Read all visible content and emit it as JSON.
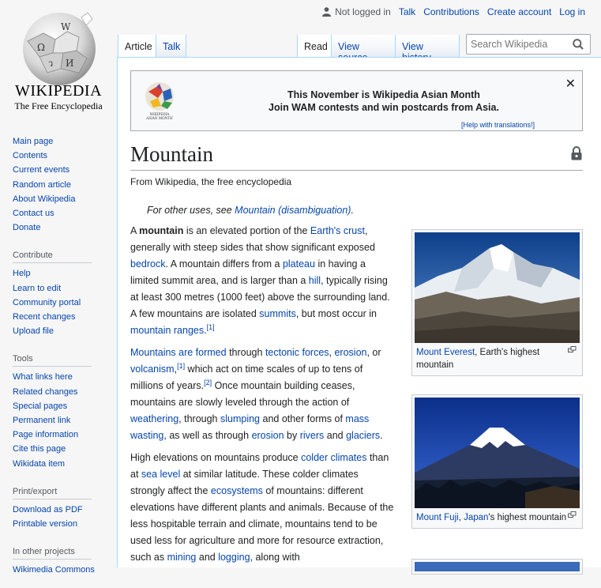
{
  "personal": {
    "not_logged_in": "Not logged in",
    "talk": "Talk",
    "contributions": "Contributions",
    "create_account": "Create account",
    "log_in": "Log in"
  },
  "logo": {
    "wordmark": "WIKIPEDIA",
    "tagline": "The Free Encyclopedia"
  },
  "sidebar": {
    "navigation": [
      "Main page",
      "Contents",
      "Current events",
      "Random article",
      "About Wikipedia",
      "Contact us",
      "Donate"
    ],
    "contribute_heading": "Contribute",
    "contribute": [
      "Help",
      "Learn to edit",
      "Community portal",
      "Recent changes",
      "Upload file"
    ],
    "tools_heading": "Tools",
    "tools": [
      "What links here",
      "Related changes",
      "Special pages",
      "Permanent link",
      "Page information",
      "Cite this page",
      "Wikidata item"
    ],
    "print_heading": "Print/export",
    "print": [
      "Download as PDF",
      "Printable version"
    ],
    "projects_heading": "In other projects",
    "projects": [
      "Wikimedia Commons"
    ]
  },
  "tabs": {
    "article": "Article",
    "talk": "Talk",
    "read": "Read",
    "view_source": "View source",
    "view_history": "View history"
  },
  "search": {
    "placeholder": "Search Wikipedia"
  },
  "banner": {
    "line1": "This November is Wikipedia Asian Month",
    "line2": "Join WAM contests and win postcards from Asia.",
    "help": "[Help with translations!]",
    "logo_text": "WIKIPEDIA ASIAN MONTH"
  },
  "article": {
    "title": "Mountain",
    "from": "From Wikipedia, the free encyclopedia",
    "hatnote_prefix": "For other uses, see ",
    "hatnote_link": "Mountain (disambiguation)",
    "hatnote_suffix": "."
  },
  "thumbs": [
    {
      "link": "Mount Everest",
      "caption": ", Earth's highest mountain"
    },
    {
      "link1": "Mount Fuji",
      "sep": ", ",
      "link2": "Japan",
      "caption": "'s highest mountain"
    }
  ],
  "colors": {
    "link": "#0645ad",
    "tab_border": "#a7d7f9",
    "bg": "#f6f6f6"
  }
}
